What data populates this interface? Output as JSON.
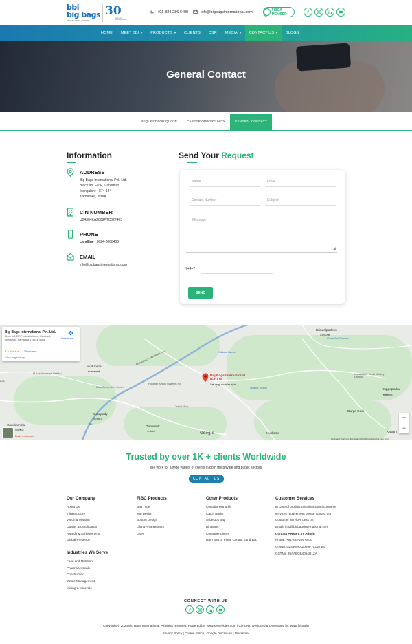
{
  "header": {
    "logo_bbi": "bbi",
    "logo_brand": "big bags",
    "logo_tagline": "DESIGN | SPEED | CONTROL",
    "logo_anniversary": "30",
    "logo_anniversary_sub": "YEARS OF BUILDING QUALITY",
    "phone": "+91-824-286 6400",
    "email": "info@bigbagsinternational.com",
    "fibca_badge": "FIBCA MEMBER",
    "socials": [
      "facebook-icon",
      "instagram-icon",
      "linkedin-icon",
      "youtube-icon"
    ]
  },
  "nav": {
    "items": [
      {
        "label": "HOME",
        "dropdown": false,
        "active": false
      },
      {
        "label": "MEET BBI",
        "dropdown": true,
        "active": false
      },
      {
        "label": "PRODUCTS",
        "dropdown": true,
        "active": false
      },
      {
        "label": "CLIENTS",
        "dropdown": false,
        "active": false
      },
      {
        "label": "CSR",
        "dropdown": false,
        "active": false
      },
      {
        "label": "MEDIA",
        "dropdown": true,
        "active": false
      },
      {
        "label": "CONTACT US",
        "dropdown": true,
        "active": true
      },
      {
        "label": "BLOGS",
        "dropdown": false,
        "active": false
      }
    ]
  },
  "hero": {
    "title": "General Contact"
  },
  "subtabs": [
    {
      "label": "REQUEST FOR QUOTE",
      "active": false
    },
    {
      "label": "CAREER OPPORTUNITY",
      "active": false
    },
    {
      "label": "GENERAL CONTACT",
      "active": true
    }
  ],
  "information": {
    "title": "Information",
    "address": {
      "title": "ADDRESS",
      "lines": [
        "Big Bags International Pvt. Ltd.",
        "Block #8, EPIP, Ganjimutt",
        "Mangalore - 574 144",
        "Karnataka, INDIA"
      ]
    },
    "cin": {
      "title": "CIN NUMBER",
      "value": "U24304KA2009PTC027403"
    },
    "phone": {
      "title": "PHONE",
      "label": "Landline",
      "value": ": 0824-2866400"
    },
    "email": {
      "title": "EMAIL",
      "value": "info@bigbagsinternational.com"
    }
  },
  "form": {
    "title_part1": "Send Your ",
    "title_part2": "Request",
    "name_placeholder": "Name",
    "email_placeholder": "Email",
    "contact_placeholder": "Contact Number",
    "subject_placeholder": "Subject",
    "message_placeholder": "Message",
    "captcha": "7+4=?",
    "submit_label": "SEND"
  },
  "map": {
    "card": {
      "title": "Big Bags International Pvt. Ltd.",
      "address": "Block -#8, EPIP Industrial Area, Ganjimutt, Mangaluru, Karnataka 574144, India",
      "rating": "4.2",
      "stars": "★★★★☆",
      "reviews": "35 reviews",
      "larger_map": "View larger map",
      "directions": "Directions"
    },
    "labels": {
      "place_pin": "Big Bags International Pvt. Ltd",
      "place_pin_local": "ಬಿಗ್ ಬ್ಯಾಗ್ಸ್ ಇಂಟರ್‌ನ್ಯಾಷನಲ್",
      "brindalpadavu": "Brindalpadavu",
      "brindalpadavu_local": "ಬ್ರಿಂದಲ್ಪದವು",
      "shree_sai": "Shree Sai Cashew",
      "oddoor_farms": "Oddoor Farms",
      "muduperar": "Muduperar",
      "muduperar_local": "ಮುದುಪೆರಾರ್",
      "madhavaraya": "M. Madhavaraya Prabhu",
      "zara": "Zara Convention Centre",
      "flipower": "Flipower Aircon Systems Pvt",
      "oddoor_school": "Oddoor school",
      "trend_visor": "Trend Visor",
      "immaculate": "Immaculate Heart of Mary Church",
      "kuppepadav": "Kuppepadav",
      "kuppepadav_local": "ಕುಪ್ಪೆಪದವು",
      "durga_kodi": "Durga Kodi",
      "surulpady": "Surulpady",
      "surulpady_local": "ಸೂರಲ್ಪಾಡಿ",
      "ganjimutt": "Ganjimutt",
      "ganjimutt_local": "ಗಂಜಿಮಠ",
      "gurukambla": "Gurukambla",
      "gurukambla_local": "ಗುರುಕಂಬ್ಳ",
      "kukkatte": "Kukkatte",
      "kadam": "Kadam",
      "atc": "ATC",
      "road_169": "169",
      "fada": "Fada restaurant",
      "mangaluru": "Mangaluru – Moodbidri Hwy"
    },
    "google": "Google",
    "footer": "Keyboard shortcuts   Map data ©2024   Terms   Report a map error",
    "zoom_in": "+",
    "zoom_out": "−"
  },
  "trusted": {
    "title": "Trusted by over 1K + clients Worldwide",
    "subtitle": "We work for a wide variety of clients in both the private and public sectors",
    "button": "CONTACT US"
  },
  "footer": {
    "our_company": {
      "title": "Our Company",
      "items": [
        "About Us",
        "Infrastructure",
        "Vision & Mission",
        "Quality & Certification",
        "Awards & Achievements",
        "Global Presence"
      ]
    },
    "industries": {
      "title": "Industries We Serve",
      "items": [
        "Food and Nutrition",
        "Pharmaceuticals",
        "Construction",
        "Waste Management",
        "Mining & Minerals"
      ]
    },
    "fibc": {
      "title": "FIBC Products",
      "items": [
        "Bag Type",
        "Top Design",
        "Bottom Design",
        "Lifting Arrangement",
        "Liner"
      ]
    },
    "other": {
      "title": "Other Products",
      "items": [
        "Containment Brills",
        "Catch Basin",
        "Asbestos Bag",
        "Bin Bags",
        "Container Liners",
        "Dam Bag or Flood Control Sand Bag"
      ]
    },
    "customer": {
      "title": "Customer Services",
      "lines": [
        "In case of product complaints and customer",
        "services requirement please contact our",
        "Customer services desk by:",
        "Email: info@bigbagsinternational.com"
      ],
      "person": "Contact Person : IT Admin",
      "details": [
        "Phone: +91-824-286 6400",
        "CINNo: U24304KA2009PTC027403",
        "GSTNo: 29AABCB4064Q1ZA"
      ]
    },
    "connect": "CONNECT WITH US",
    "socials": [
      "facebook-icon",
      "instagram-icon",
      "linkedin-icon",
      "youtube-icon"
    ],
    "copyright": "Copyright © 2024 Big Bags International. All rights reserved. Powered by: www.serverkites.com | Concept, Designed & Developed by: www.fyiora.in",
    "policies": "Privacy Policy | Cookie Policy | Google Disclosure | Disclaimer"
  }
}
